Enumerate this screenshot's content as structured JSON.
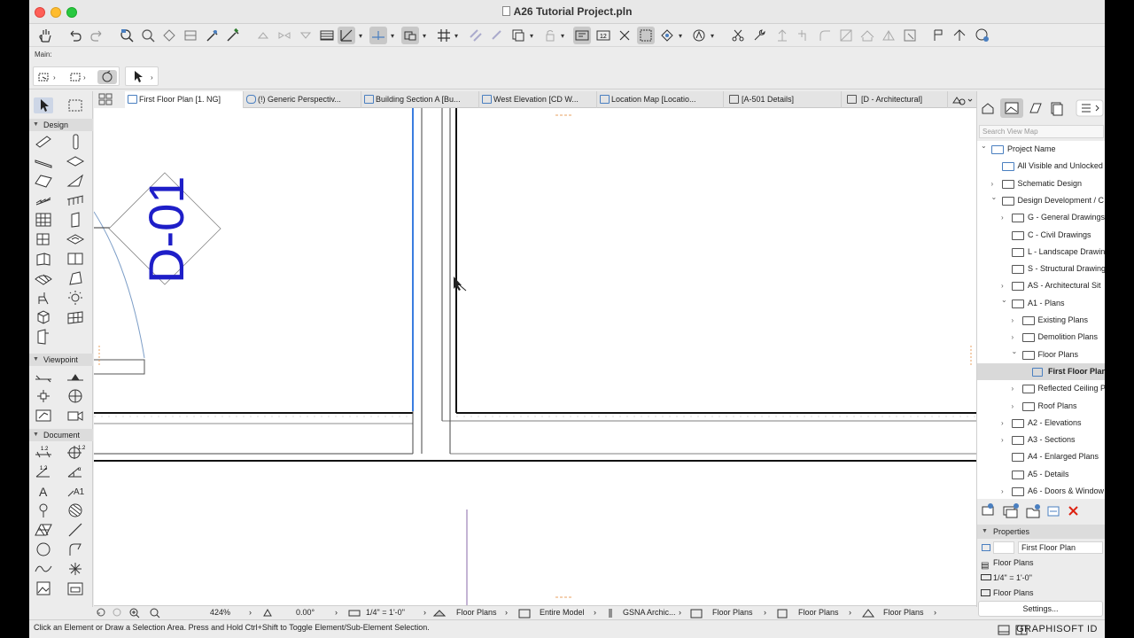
{
  "window": {
    "title": "A26 Tutorial Project.pln"
  },
  "toolbar": {
    "main_label": "Main:",
    "icons": [
      "pan-icon",
      "undo-icon",
      "redo-icon",
      "find-select-icon",
      "magic-wand-icon",
      "eyedropper-icon",
      "syringe-icon",
      "trace-icon",
      "fill-icon",
      "suspend-groups-icon",
      "layout-icon",
      "snap-guide-icon",
      "grid-icon",
      "align-icon",
      "renovation-icon",
      "markup-icon",
      "dimension-icon"
    ]
  },
  "tabs": [
    {
      "label": "First Floor Plan [1. NG]",
      "active": true
    },
    {
      "label": "(!) Generic Perspectiv..."
    },
    {
      "label": "Building Section A [Bu..."
    },
    {
      "label": "West Elevation [CD W..."
    },
    {
      "label": "Location Map [Locatio..."
    },
    {
      "label": "[A-501 Details]"
    },
    {
      "label": "[D - Architectural]"
    }
  ],
  "toolbox": {
    "design_label": "Design",
    "viewpoint_label": "Viewpoint",
    "document_label": "Document"
  },
  "canvas": {
    "tag_text": "D-01"
  },
  "navigator": {
    "search_placeholder": "Search View Map",
    "tree": [
      {
        "label": "Project Name",
        "level": 0,
        "chev": "down"
      },
      {
        "label": "All Visible and Unlocked",
        "level": 1,
        "chev": ""
      },
      {
        "label": "Schematic Design",
        "level": 1,
        "chev": "right"
      },
      {
        "label": "Design Development / C",
        "level": 1,
        "chev": "down"
      },
      {
        "label": "G - General Drawings",
        "level": 2,
        "chev": "right"
      },
      {
        "label": "C - Civil Drawings",
        "level": 2,
        "chev": ""
      },
      {
        "label": "L - Landscape Drawin",
        "level": 2,
        "chev": ""
      },
      {
        "label": "S - Structural Drawing",
        "level": 2,
        "chev": ""
      },
      {
        "label": "AS - Architectural Sit",
        "level": 2,
        "chev": "right"
      },
      {
        "label": "A1 - Plans",
        "level": 2,
        "chev": "down"
      },
      {
        "label": "Existing Plans",
        "level": 3,
        "chev": "right"
      },
      {
        "label": "Demolition Plans",
        "level": 3,
        "chev": "right"
      },
      {
        "label": "Floor Plans",
        "level": 3,
        "chev": "down"
      },
      {
        "label": "First Floor Plan",
        "level": 4,
        "chev": "",
        "selected": true
      },
      {
        "label": "Reflected Ceiling P",
        "level": 3,
        "chev": "right"
      },
      {
        "label": "Roof Plans",
        "level": 3,
        "chev": "right"
      },
      {
        "label": "A2 - Elevations",
        "level": 2,
        "chev": "right"
      },
      {
        "label": "A3 - Sections",
        "level": 2,
        "chev": "right"
      },
      {
        "label": "A4 - Enlarged Plans",
        "level": 2,
        "chev": ""
      },
      {
        "label": "A5 - Details",
        "level": 2,
        "chev": ""
      },
      {
        "label": "A6 - Doors & Window",
        "level": 2,
        "chev": "right"
      }
    ],
    "properties_label": "Properties",
    "prop_name": "First Floor Plan",
    "prop_layer": "Floor Plans",
    "prop_scale": "1/4\"   =   1'-0\"",
    "prop_layer2": "Floor Plans",
    "settings_label": "Settings..."
  },
  "bottom": {
    "zoom": "424%",
    "angle": "0.00°",
    "scale": "1/4\"   =   1'-0\"",
    "layer": "Floor Plans",
    "model": "Entire Model",
    "pen": "GSNA Archic...",
    "view1": "Floor Plans",
    "view2": "Floor Plans",
    "view3": "Floor Plans"
  },
  "status": {
    "message": "Click an Element or Draw a Selection Area. Press and Hold Ctrl+Shift to Toggle Element/Sub-Element Selection.",
    "brand": "GRAPHISOFT ID"
  }
}
